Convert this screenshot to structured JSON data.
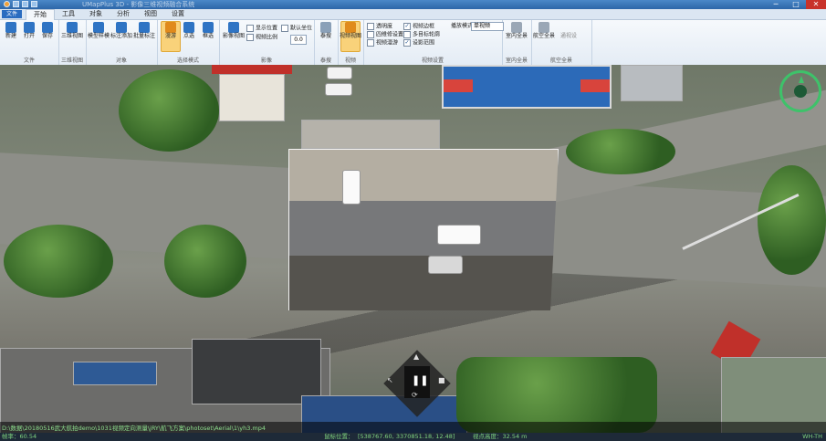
{
  "window": {
    "title": "UMapPlus 3D - 影像三维视频融合系统",
    "controls": [
      "─",
      "□",
      "✕"
    ]
  },
  "tabs": {
    "file": "文件",
    "items": [
      "开始",
      "工具",
      "对象",
      "分析",
      "视图",
      "设置"
    ],
    "active": 0
  },
  "ribbon": {
    "groups": [
      {
        "label": "文件",
        "buttons": [
          "新建",
          "打开",
          "保存"
        ]
      },
      {
        "label": "三维视图",
        "buttons": [
          "三维视图"
        ]
      },
      {
        "label": "对象",
        "buttons": [
          "模型样模",
          "标注添加",
          "批量标注"
        ]
      },
      {
        "label": "选择模式",
        "buttons": [
          "漫游",
          "点选",
          "框选"
        ]
      },
      {
        "label": "影像",
        "buttons": [
          "影像视图"
        ]
      },
      {
        "label": "泰搜",
        "buttons": [
          "泰搜"
        ]
      },
      {
        "label": "视频",
        "buttons": [
          "视频视图"
        ]
      },
      {
        "label": "视频设置",
        "buttons": []
      },
      {
        "label": "室内全景",
        "buttons": [
          "室内全景"
        ]
      },
      {
        "label": "航空全景",
        "buttons": [
          "航空全景",
          "通视设"
        ]
      }
    ],
    "image_options": {
      "show_position": "显示位置",
      "default_position": "默认坐位",
      "align_scale": "视频比例",
      "value": "0.0"
    },
    "video_options": {
      "opt1": "透明度",
      "opt2": "四维修设置",
      "opt3": "视频漫游",
      "opt4": "视频边框",
      "opt5": "多目标轮廓",
      "opt6": "设影范围",
      "mode_label": "播放模式",
      "mode_value": "单视频"
    }
  },
  "scene": {
    "compass": "compass"
  },
  "pathbar": {
    "text": "D:\\数据\\20180516武大航拍demo\\1031视频定向测量\\jRY\\航飞方案\\photoset\\Aerial\\1\\yh3.mp4"
  },
  "status": {
    "fps_label": "帧率：60.54",
    "pos_label": "鼠标位置：",
    "pos_value": "[538767.60, 3370851.18, 12.48]",
    "height_label": "视点高度：32.54 m",
    "right": "WH-TH"
  }
}
